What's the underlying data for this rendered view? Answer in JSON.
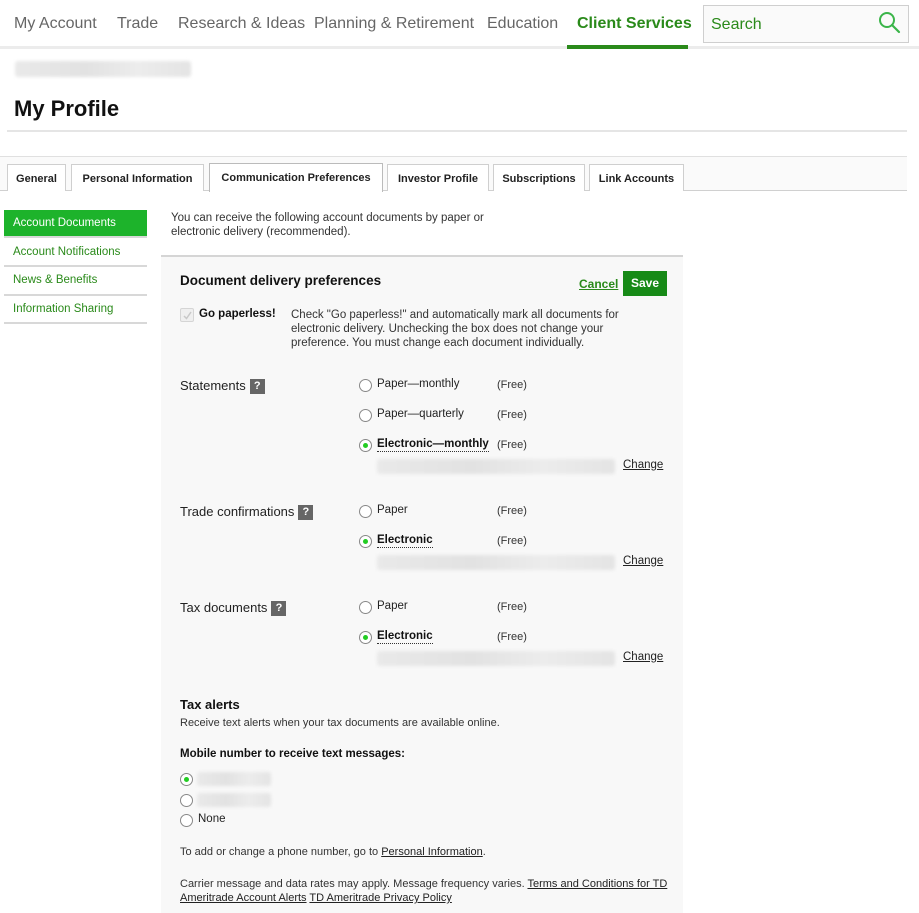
{
  "topnav": {
    "items": [
      {
        "label": "My Account",
        "active": false
      },
      {
        "label": "Trade",
        "active": false
      },
      {
        "label": "Research & Ideas",
        "active": false
      },
      {
        "label": "Planning & Retirement",
        "active": false
      },
      {
        "label": "Education",
        "active": false
      },
      {
        "label": "Client Services",
        "active": true
      }
    ],
    "search_placeholder": "Search"
  },
  "page": {
    "title": "My Profile"
  },
  "tabs": [
    {
      "label": "General",
      "active": false
    },
    {
      "label": "Personal Information",
      "active": false
    },
    {
      "label": "Communication Preferences",
      "active": true
    },
    {
      "label": "Investor Profile",
      "active": false
    },
    {
      "label": "Subscriptions",
      "active": false
    },
    {
      "label": "Link Accounts",
      "active": false
    }
  ],
  "sidebar": {
    "items": [
      {
        "label": "Account Documents",
        "active": true
      },
      {
        "label": "Account Notifications",
        "active": false
      },
      {
        "label": "News & Benefits",
        "active": false
      },
      {
        "label": "Information Sharing",
        "active": false
      }
    ]
  },
  "main": {
    "intro": "You can receive the following account documents by paper or electronic delivery (recommended).",
    "panel_title": "Document delivery preferences",
    "cancel_label": "Cancel",
    "save_label": "Save",
    "go_paperless": {
      "label": "Go paperless!",
      "checked": true,
      "description": "Check \"Go paperless!\" and automatically mark all documents for electronic delivery. Unchecking the box does not change your preference. You must change each document individually."
    },
    "groups": [
      {
        "label": "Statements",
        "options": [
          {
            "label": "Paper—monthly",
            "price": "(Free)",
            "checked": false
          },
          {
            "label": "Paper—quarterly",
            "price": "(Free)",
            "checked": false
          },
          {
            "label": "Electronic—monthly",
            "price": "(Free)",
            "checked": true
          }
        ],
        "change_label": "Change"
      },
      {
        "label": "Trade confirmations",
        "options": [
          {
            "label": "Paper",
            "price": "(Free)",
            "checked": false
          },
          {
            "label": "Electronic",
            "price": "(Free)",
            "checked": true
          }
        ],
        "change_label": "Change"
      },
      {
        "label": "Tax documents",
        "options": [
          {
            "label": "Paper",
            "price": "(Free)",
            "checked": false
          },
          {
            "label": "Electronic",
            "price": "(Free)",
            "checked": true
          }
        ],
        "change_label": "Change"
      }
    ],
    "tax_alerts": {
      "title": "Tax alerts",
      "description": "Receive text alerts when your tax documents are available online.",
      "mobile_label": "Mobile number to receive text messages:",
      "none_label": "None",
      "phone_note_prefix": "To add or change a phone number, go to ",
      "phone_note_link": "Personal Information",
      "phone_note_suffix": ".",
      "carrier_text": "Carrier message and data rates may apply. Message frequency varies. ",
      "terms_link": "Terms and Conditions for TD Ameritrade Account Alerts",
      "privacy_link": "TD Ameritrade Privacy Policy"
    }
  },
  "colors": {
    "brand_green": "#2a8a1a",
    "active_sidebar": "#1db32b",
    "save_button": "#178a17",
    "radio_dot": "#22cc22"
  }
}
